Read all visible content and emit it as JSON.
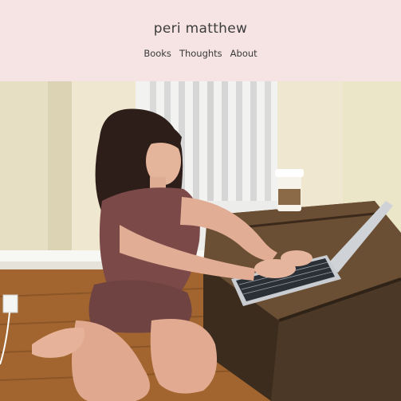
{
  "site": {
    "title": "peri matthew"
  },
  "nav": {
    "items": [
      "Books",
      "Thoughts",
      "About"
    ]
  },
  "colors": {
    "header_bg": "#f6e4e4",
    "text": "#3c3c3c"
  },
  "hero": {
    "subject": "woman-typing-on-laptop-photo"
  }
}
